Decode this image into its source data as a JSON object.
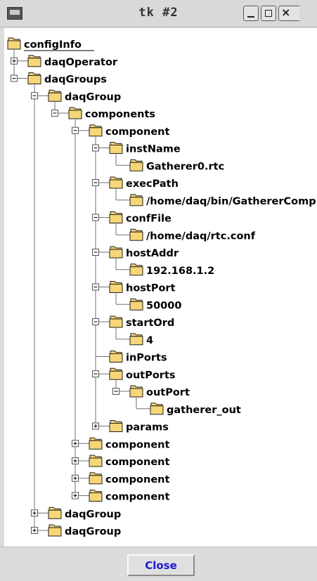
{
  "window": {
    "title": "tk #2"
  },
  "titlebar_buttons": {
    "minimize": "_",
    "maximize": "□",
    "close": "×"
  },
  "tree": {
    "nodes": [
      {
        "label": "configInfo",
        "depth": 0,
        "state": "none"
      },
      {
        "label": "daqOperator",
        "depth": 1,
        "state": "collapsed"
      },
      {
        "label": "daqGroups",
        "depth": 1,
        "state": "expanded"
      },
      {
        "label": "daqGroup",
        "depth": 2,
        "state": "expanded"
      },
      {
        "label": "components",
        "depth": 3,
        "state": "expanded"
      },
      {
        "label": "component",
        "depth": 4,
        "state": "expanded"
      },
      {
        "label": "instName",
        "depth": 5,
        "state": "expanded"
      },
      {
        "label": "Gatherer0.rtc",
        "depth": 6,
        "state": "none"
      },
      {
        "label": "execPath",
        "depth": 5,
        "state": "expanded"
      },
      {
        "label": "/home/daq/bin/GathererComp",
        "depth": 6,
        "state": "none"
      },
      {
        "label": "confFile",
        "depth": 5,
        "state": "expanded"
      },
      {
        "label": "/home/daq/rtc.conf",
        "depth": 6,
        "state": "none"
      },
      {
        "label": "hostAddr",
        "depth": 5,
        "state": "expanded"
      },
      {
        "label": "192.168.1.2",
        "depth": 6,
        "state": "none"
      },
      {
        "label": "hostPort",
        "depth": 5,
        "state": "expanded"
      },
      {
        "label": "50000",
        "depth": 6,
        "state": "none"
      },
      {
        "label": "startOrd",
        "depth": 5,
        "state": "expanded"
      },
      {
        "label": "4",
        "depth": 6,
        "state": "none"
      },
      {
        "label": "inPorts",
        "depth": 5,
        "state": "none"
      },
      {
        "label": "outPorts",
        "depth": 5,
        "state": "expanded"
      },
      {
        "label": "outPort",
        "depth": 6,
        "state": "expanded"
      },
      {
        "label": "gatherer_out",
        "depth": 7,
        "state": "none"
      },
      {
        "label": "params",
        "depth": 5,
        "state": "collapsed"
      },
      {
        "label": "component",
        "depth": 4,
        "state": "collapsed"
      },
      {
        "label": "component",
        "depth": 4,
        "state": "collapsed"
      },
      {
        "label": "component",
        "depth": 4,
        "state": "collapsed"
      },
      {
        "label": "component",
        "depth": 4,
        "state": "collapsed"
      },
      {
        "label": "daqGroup",
        "depth": 2,
        "state": "collapsed"
      },
      {
        "label": "daqGroup",
        "depth": 2,
        "state": "collapsed"
      }
    ]
  },
  "footer": {
    "close_label": "Close"
  },
  "colors": {
    "folder_fill": "#f6d676",
    "folder_stroke": "#222222",
    "tree_line": "#707070",
    "button_text": "#1a1ad0"
  }
}
